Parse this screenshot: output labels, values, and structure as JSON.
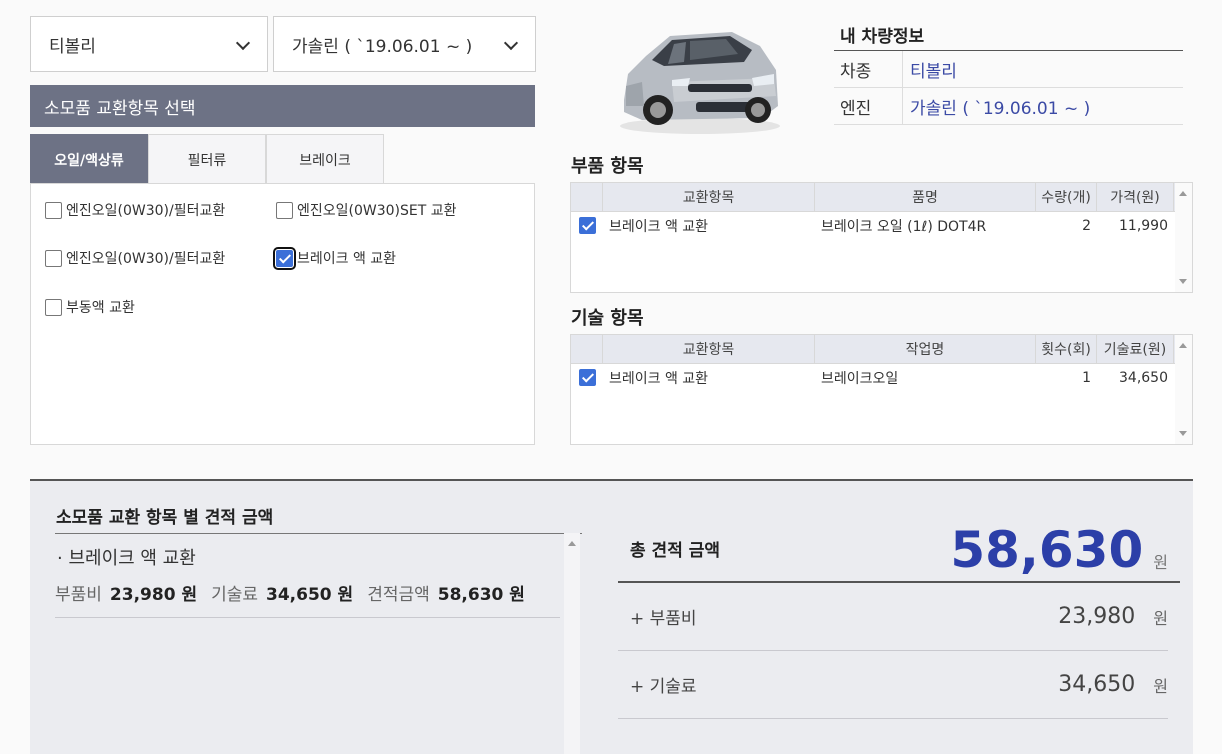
{
  "selects": {
    "model": "티볼리",
    "engine": "가솔린 ( `19.06.01 ~ )"
  },
  "section_title": "소모품 교환항목 선택",
  "tabs": [
    {
      "label": "오일/액상류",
      "active": true
    },
    {
      "label": "필터류",
      "active": false
    },
    {
      "label": "브레이크",
      "active": false
    }
  ],
  "checks": [
    {
      "label": "엔진오일(0W30)/필터교환",
      "checked": false
    },
    {
      "label": "엔진오일(0W30)SET 교환",
      "checked": false
    },
    {
      "label": "엔진오일(0W30)/필터교환",
      "checked": false
    },
    {
      "label": "브레이크 액 교환",
      "checked": true
    },
    {
      "label": "부동액 교환",
      "checked": false
    }
  ],
  "vehicle_info": {
    "title": "내 차량정보",
    "rows": [
      {
        "key": "차종",
        "value": "티볼리"
      },
      {
        "key": "엔진",
        "value": "가솔린 ( `19.06.01 ~ )"
      }
    ]
  },
  "parts": {
    "title": "부품 항목",
    "headers": [
      "교환항목",
      "품명",
      "수량(개)",
      "가격(원)"
    ],
    "rows": [
      {
        "item": "브레이크 액 교환",
        "name": "브레이크 오일 (1ℓ) DOT4R",
        "qty": "2",
        "price": "11,990"
      }
    ]
  },
  "labor": {
    "title": "기술 항목",
    "headers": [
      "교환항목",
      "작업명",
      "횟수(회)",
      "기술료(원)"
    ],
    "rows": [
      {
        "item": "브레이크 액 교환",
        "name": "브레이크오일",
        "qty": "1",
        "price": "34,650"
      }
    ]
  },
  "estimate": {
    "title": "소모품 교환 항목 별 견적 금액",
    "items": [
      {
        "name": "· 브레이크 액 교환",
        "parts_label": "부품비",
        "parts_value": "23,980 원",
        "labor_label": "기술료",
        "labor_value": "34,650 원",
        "total_label": "견적금액",
        "total_value": "58,630 원"
      }
    ]
  },
  "total": {
    "label": "총 견적 금액",
    "amount": "58,630",
    "unit": "원",
    "rows": [
      {
        "label": "+ 부품비",
        "amount": "23,980",
        "unit": "원"
      },
      {
        "label": "+ 기술료",
        "amount": "34,650",
        "unit": "원"
      }
    ]
  },
  "colors": {
    "accent": "#2c3fa8",
    "header_bar": "#6d7285",
    "checkbox": "#3b6fd8"
  }
}
